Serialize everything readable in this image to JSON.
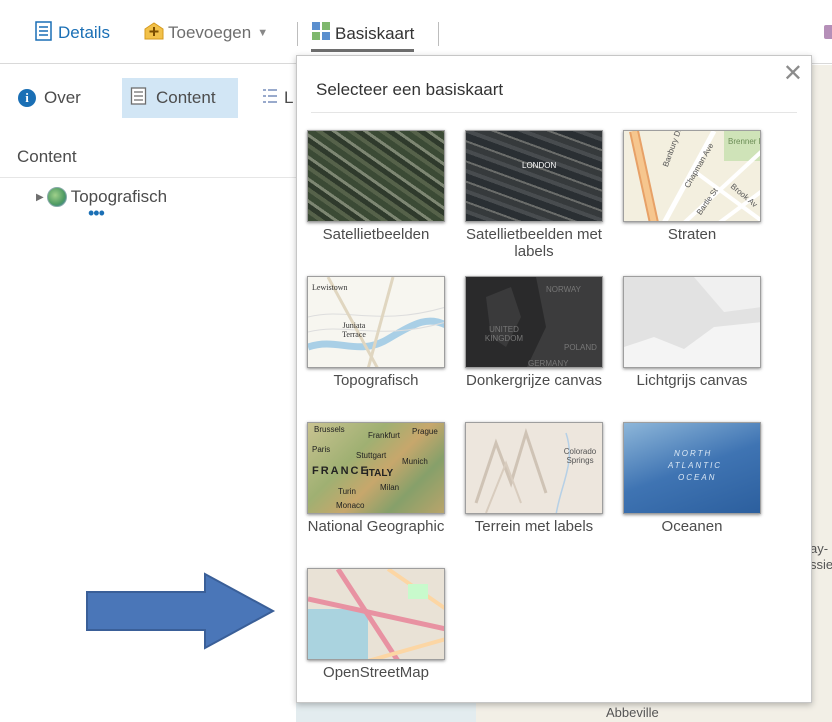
{
  "toolbar": {
    "details_label": "Details",
    "add_label": "Toevoegen",
    "basemap_label": "Basiskaart"
  },
  "left_panel": {
    "tabs": [
      {
        "label": "Over",
        "active": false
      },
      {
        "label": "Content",
        "active": true
      },
      {
        "label": "L",
        "active": false
      }
    ],
    "heading": "Content",
    "layers": [
      {
        "label": "Topografisch"
      }
    ]
  },
  "map_background": {
    "partial_labels": [
      "ay-",
      "ssie",
      "Abbeville"
    ]
  },
  "basemap_gallery": {
    "title": "Selecteer een basiskaart",
    "close_icon": "close-icon",
    "items": [
      {
        "label": "Satellietbeelden",
        "thumb_text": []
      },
      {
        "label": "Satellietbeelden met labels",
        "thumb_text": [
          "LONDON"
        ]
      },
      {
        "label": "Straten",
        "thumb_text": [
          "Brenner Park",
          "Chapman Ave",
          "Brook Av",
          "Bartle St",
          "Banbury Dr"
        ]
      },
      {
        "label": "Topografisch",
        "thumb_text": [
          "Lewistown",
          "Juniata Terrace"
        ]
      },
      {
        "label": "Donkergrijze canvas",
        "thumb_text": [
          "NORWAY",
          "UNITED KINGDOM",
          "POLAND",
          "GERMANY"
        ]
      },
      {
        "label": "Lichtgrijs canvas",
        "thumb_text": []
      },
      {
        "label": "National Geographic",
        "thumb_text": [
          "Brussels",
          "Frankfurt",
          "Prague",
          "Paris",
          "Stuttgart",
          "Munich",
          "FRANCE",
          "ITALY",
          "Milan",
          "Turin",
          "Monaco"
        ]
      },
      {
        "label": "Terrein met labels",
        "thumb_text": [
          "Colorado Springs"
        ]
      },
      {
        "label": "Oceanen",
        "thumb_text": [
          "NORTH",
          "ATLANTIC",
          "OCEAN"
        ]
      },
      {
        "label": "OpenStreetMap",
        "thumb_text": []
      }
    ]
  },
  "annotation": {
    "arrow_color": "#4a76b8"
  }
}
